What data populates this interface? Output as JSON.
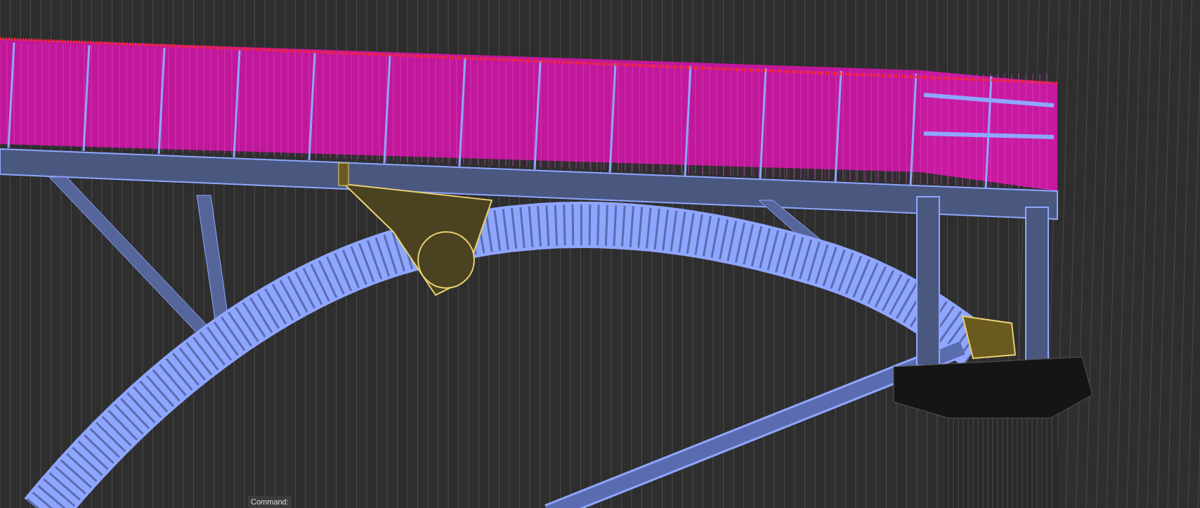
{
  "command_line": {
    "prompt": "Command:"
  }
}
